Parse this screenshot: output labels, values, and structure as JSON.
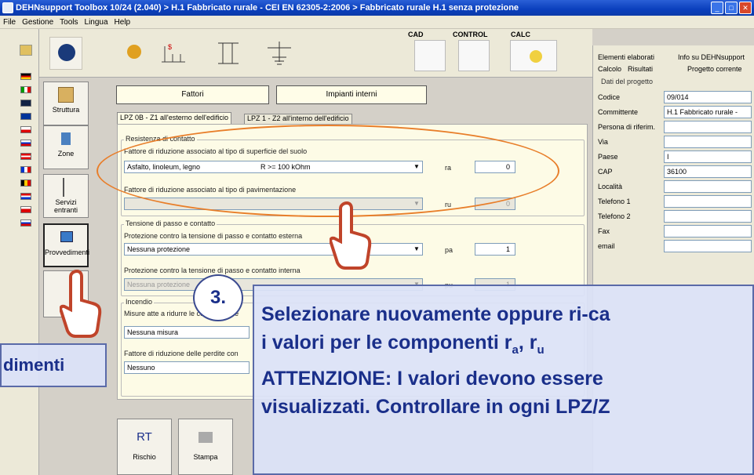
{
  "window": {
    "title": "DEHNsupport Toolbox 10/24 (2.040) > H.1  Fabbricato rurale - CEI EN 62305-2:2006 > Fabbricato rurale H.1  senza protezione"
  },
  "menu": [
    "File",
    "Gestione",
    "Tools",
    "Lingua",
    "Help"
  ],
  "toolbar": {
    "cad": "CAD",
    "control": "CONTROL",
    "calc": "CALC"
  },
  "side": {
    "struttura": "Struttura",
    "zone": "Zone",
    "servizi": "Servizi entranti",
    "provvedimenti": "Provvedimenti"
  },
  "topbuttons": {
    "fattori": "Fattori",
    "impianti": "Impianti interni"
  },
  "tabs": {
    "lpz0": "LPZ 0B - Z1 all'esterno dell'edificio",
    "lpz1": "LPZ 1 - Z2 all'interno dell'edificio"
  },
  "resistenza": {
    "title": "Resistenza di contatto",
    "l1": "Fattore di riduzione associato al tipo di superficie del suolo",
    "c1": "Asfalto, linoleum, legno",
    "c1b": "R >= 100 kOhm",
    "ra_label": "ra",
    "ra": "0",
    "l2": "Fattore di riduzione associato al tipo di pavimentazione",
    "ru_label": "ru",
    "ru": "0"
  },
  "tensione": {
    "title": "Tensione di passo e contatto",
    "l1": "Protezione contro la tensione di passo e contatto esterna",
    "c1": "Nessuna protezione",
    "pa_label": "pa",
    "pa": "1",
    "l2": "Protezione contro la tensione di passo e contatto interna",
    "c2": "Nessuna protezione",
    "pu_label": "pu",
    "pu": "1"
  },
  "incendio": {
    "title": "Incendio",
    "l1": "Misure atte a ridurre le conseguenze",
    "c1": "Nessuna misura",
    "l2": "Fattore di riduzione delle perdite con",
    "c2": "Nessuno"
  },
  "right": {
    "tab1": "Elementi elaborati",
    "tab2": "Info su DEHNsupport",
    "tab3": "Calcolo",
    "tab4": "Risultati",
    "tab5": "Progetto corrente",
    "group": "Dati del progetto",
    "fields": [
      {
        "label": "Codice",
        "value": "09/014"
      },
      {
        "label": "Committente",
        "value": "H.1  Fabbricato rurale -"
      },
      {
        "label": "Persona di riferim.",
        "value": ""
      },
      {
        "label": "Via",
        "value": ""
      },
      {
        "label": "Paese",
        "value": "I"
      },
      {
        "label": "CAP",
        "value": "36100"
      },
      {
        "label": "Località",
        "value": ""
      },
      {
        "label": "Telefono 1",
        "value": ""
      },
      {
        "label": "Telefono 2",
        "value": ""
      },
      {
        "label": "Fax",
        "value": ""
      },
      {
        "label": "email",
        "value": ""
      }
    ]
  },
  "bottom": {
    "rischio_icon": "RT",
    "rischio": "Rischio",
    "stampa": "Stampa"
  },
  "callout": {
    "step": "3.",
    "line1": "Selezionare nuovamente oppure ri-ca",
    "line2a": "i valori per le componenti  r",
    "line2b": "a",
    "line2c": ", r",
    "line2d": "u",
    "line3": "ATTENZIONE: I valori devono essere",
    "line4": "visualizzati. Controllare in ogni LPZ/Z",
    "small": "dimenti"
  },
  "colors": {
    "title": "#0a3fbd",
    "callout_text": "#1a2f8a",
    "ellipse": "#e87e2a"
  }
}
